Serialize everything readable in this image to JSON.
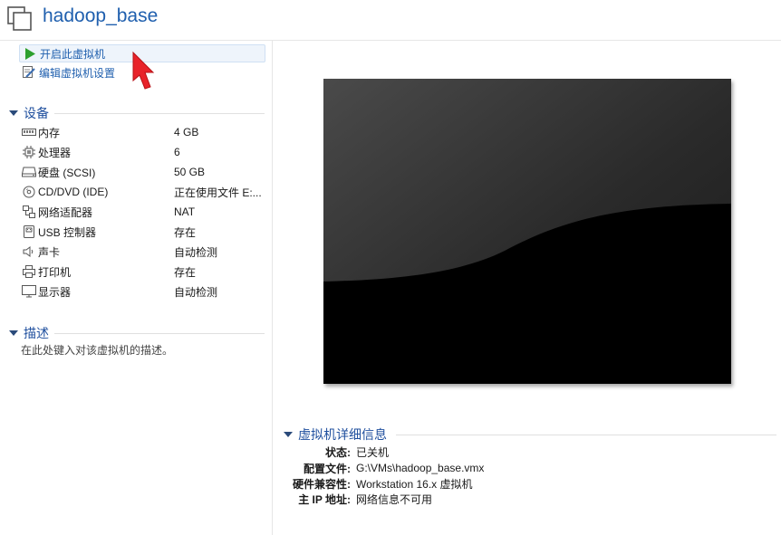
{
  "header": {
    "title": "hadoop_base",
    "icon": "vm-copy-icon"
  },
  "actions": [
    {
      "label": "开启此虚拟机",
      "icon": "play-icon",
      "color": "#2ea02e"
    },
    {
      "label": "编辑虚拟机设置",
      "icon": "edit-settings-icon"
    }
  ],
  "devices": {
    "title": "设备",
    "items": [
      {
        "name": "内存",
        "value": "4 GB",
        "icon": "memory-icon"
      },
      {
        "name": "处理器",
        "value": "6",
        "icon": "cpu-icon"
      },
      {
        "name": "硬盘 (SCSI)",
        "value": "50 GB",
        "icon": "hard-disk-icon"
      },
      {
        "name": "CD/DVD (IDE)",
        "value": "正在使用文件 E:...",
        "icon": "cd-dvd-icon"
      },
      {
        "name": "网络适配器",
        "value": "NAT",
        "icon": "network-adapter-icon"
      },
      {
        "name": "USB 控制器",
        "value": "存在",
        "icon": "usb-icon"
      },
      {
        "name": "声卡",
        "value": "自动检测",
        "icon": "speaker-icon"
      },
      {
        "name": "打印机",
        "value": "存在",
        "icon": "printer-icon"
      },
      {
        "name": "显示器",
        "value": "自动检测",
        "icon": "monitor-icon"
      }
    ]
  },
  "description": {
    "title": "描述",
    "placeholder": "在此处键入对该虚拟机的描述。"
  },
  "details": {
    "title": "虚拟机详细信息",
    "rows": [
      {
        "key": "状态:",
        "value": "已关机"
      },
      {
        "key": "配置文件:",
        "value": "G:\\VMs\\hadoop_base.vmx"
      },
      {
        "key": "硬件兼容性:",
        "value": "Workstation 16.x 虚拟机"
      },
      {
        "key": "主 IP 地址:",
        "value": "网络信息不可用"
      }
    ]
  },
  "colors": {
    "accent": "#1f5fae",
    "play": "#2ea02e",
    "cursor": "#e8232a"
  }
}
